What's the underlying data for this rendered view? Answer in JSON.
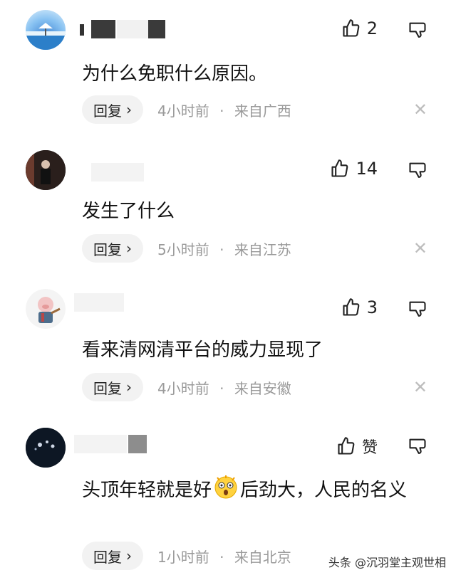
{
  "comments": [
    {
      "likes": "2",
      "text": "为什么免职什么原因。",
      "reply": "回复",
      "time": "4小时前",
      "location": "来自广西"
    },
    {
      "likes": "14",
      "text": "发生了什么",
      "reply": "回复",
      "time": "5小时前",
      "location": "来自江苏"
    },
    {
      "likes": "3",
      "text": "看来清网清平台的威力显现了",
      "reply": "回复",
      "time": "4小时前",
      "location": "来自安徽"
    },
    {
      "likes": "赞",
      "text_before": "头顶年轻就是好",
      "text_after": "后劲大，人民的名义",
      "reply": "回复",
      "time": "1小时前",
      "location": "来自北京"
    }
  ],
  "separator": "·",
  "icons": {
    "like": "thumbs-up-icon",
    "dislike": "thumbs-down-icon",
    "reply_arrow": "chevron-right-icon",
    "close": "close-icon",
    "emoji": "shocked-face-emoji"
  },
  "watermark": "头条 @沉羽堂主观世相",
  "colors": {
    "meta": "#9a9a9a",
    "reply_bg": "#f2f2f2",
    "close": "#bdbdbd"
  }
}
